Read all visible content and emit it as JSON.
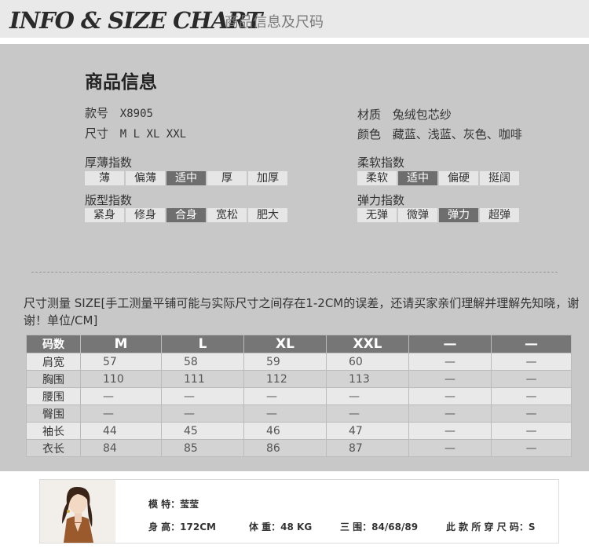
{
  "header": {
    "title_en": "INFO & SIZE CHART",
    "title_cn": "商品信息及尺码"
  },
  "product_info": {
    "title": "商品信息",
    "style_no": {
      "label": "款号",
      "value": "X8905"
    },
    "sizes": {
      "label": "尺寸",
      "value": "M L XL XXL"
    },
    "material": {
      "label": "材质",
      "value": "兔绒包芯纱"
    },
    "colors": {
      "label": "颜色",
      "value": "藏蓝、浅蓝、灰色、咖啡"
    }
  },
  "indices": {
    "thickness": {
      "label": "厚薄指数",
      "options": [
        "薄",
        "偏薄",
        "适中",
        "厚",
        "加厚"
      ],
      "selected": 2
    },
    "fit": {
      "label": "版型指数",
      "options": [
        "紧身",
        "修身",
        "合身",
        "宽松",
        "肥大"
      ],
      "selected": 2
    },
    "softness": {
      "label": "柔软指数",
      "options": [
        "柔软",
        "适中",
        "偏硬",
        "挺阔"
      ],
      "selected": 1
    },
    "elasticity": {
      "label": "弹力指数",
      "options": [
        "无弹",
        "微弹",
        "弹力",
        "超弹"
      ],
      "selected": 2
    }
  },
  "note": "尺寸测量 SIZE[手工测量平铺可能与实际尺寸之间存在1-2CM的误差，还请买家亲们理解并理解先知晓，谢谢！单位/CM]",
  "size_table": {
    "headers": [
      "码数",
      "M",
      "L",
      "XL",
      "XXL",
      "—",
      "—"
    ],
    "rows": [
      [
        "肩宽",
        "57",
        "58",
        "59",
        "60",
        "—",
        "—"
      ],
      [
        "胸围",
        "110",
        "111",
        "112",
        "113",
        "—",
        "—"
      ],
      [
        "腰围",
        "—",
        "—",
        "—",
        "—",
        "—",
        "—"
      ],
      [
        "臀围",
        "—",
        "—",
        "—",
        "—",
        "—",
        "—"
      ],
      [
        "袖长",
        "44",
        "45",
        "46",
        "47",
        "—",
        "—"
      ],
      [
        "衣长",
        "84",
        "85",
        "86",
        "87",
        "—",
        "—"
      ]
    ]
  },
  "model": {
    "name": "模 特：莹莹",
    "height": "身 高：172CM",
    "weight": "体 重：48 KG",
    "measurements": "三 围：84/68/89",
    "size_worn": "此 款 所 穿 尺 码：S"
  }
}
